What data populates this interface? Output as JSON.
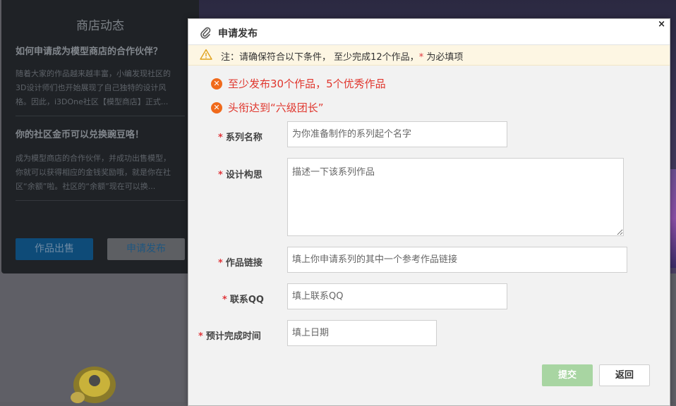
{
  "shop_panel": {
    "title": "商店动态",
    "article1_title": "如何申请成为模型商店的合作伙伴？",
    "article1_lines": [
      "随着大家的作品越来越丰富，小编发现社区的",
      "3D设计师们也开始展现了自己独特的设计风",
      "格。因此，i3DOne社区【模型商店】正式..."
    ],
    "article2_title": "你的社区金币可以兑换豌豆咯！",
    "article2_lines": [
      "成为模型商店的合作伙伴，并成功出售模型，",
      "你就可以获得相应的金钱奖励哦，就是你在社",
      "区“余额”啦。社区的“余额”现在可以换..."
    ],
    "sell_button": "作品出售",
    "apply_button": "申请发布"
  },
  "modal": {
    "title": "申请发布",
    "close": "×",
    "notice_prefix": "注：请确保符合以下条件，  至少完成12个作品，",
    "notice_star": "*",
    "notice_suffix": " 为必填项",
    "requirements": [
      "至少发布30个作品，5个优秀作品",
      "头衔达到“六级团长”"
    ],
    "form": {
      "series_name": {
        "label": "系列名称",
        "placeholder": "为你准备制作的系列起个名字"
      },
      "design_concept": {
        "label": "设计构思",
        "placeholder": "描述一下该系列作品"
      },
      "work_link": {
        "label": "作品链接",
        "placeholder": "填上你申请系列的其中一个参考作品链接"
      },
      "qq": {
        "label": "联系QQ",
        "placeholder": "填上联系QQ"
      },
      "finish_date": {
        "label": "预计完成时间",
        "placeholder": "填上日期"
      }
    },
    "required_star": "*",
    "submit_button": "提交",
    "back_button": "返回"
  },
  "colors": {
    "accent_orange": "#f06a1b",
    "error_red": "#e0362d",
    "submit_green": "#a8d5a2",
    "notice_bg": "#fdf6e3"
  },
  "icons": {
    "header": "paperclip-icon",
    "notice": "warning-icon",
    "requirement": "error-circle-icon"
  }
}
